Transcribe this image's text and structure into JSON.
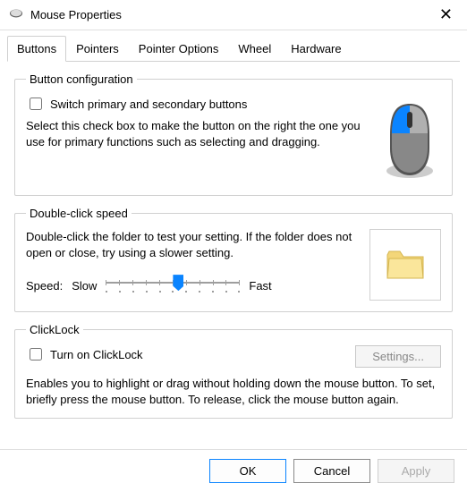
{
  "window": {
    "title": "Mouse Properties"
  },
  "tabs": {
    "buttons": "Buttons",
    "pointers": "Pointers",
    "pointer_options": "Pointer Options",
    "wheel": "Wheel",
    "hardware": "Hardware"
  },
  "button_config": {
    "legend": "Button configuration",
    "switch_label": "Switch primary and secondary buttons",
    "switch_checked": false,
    "desc": "Select this check box to make the button on the right the one you use for primary functions such as selecting and dragging."
  },
  "double_click": {
    "legend": "Double-click speed",
    "desc": "Double-click the folder to test your setting. If the folder does not open or close, try using a slower setting.",
    "speed_label": "Speed:",
    "slow_label": "Slow",
    "fast_label": "Fast"
  },
  "clicklock": {
    "legend": "ClickLock",
    "turnon_label": "Turn on ClickLock",
    "turnon_checked": false,
    "settings_label": "Settings...",
    "desc": "Enables you to highlight or drag without holding down the mouse button. To set, briefly press the mouse button. To release, click the mouse button again."
  },
  "buttons": {
    "ok": "OK",
    "cancel": "Cancel",
    "apply": "Apply"
  }
}
